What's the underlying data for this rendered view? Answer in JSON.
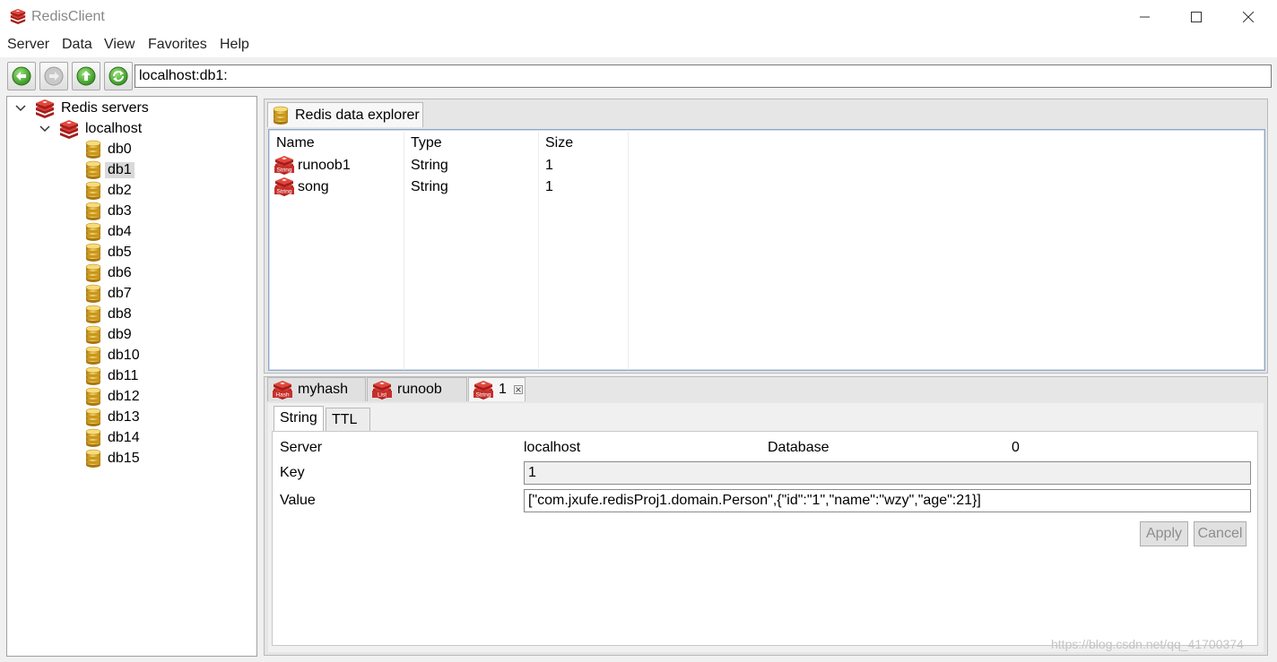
{
  "window": {
    "title": "RedisClient",
    "app_icon": "redis-icon",
    "controls": [
      "minimize-icon",
      "maximize-icon",
      "close-icon"
    ]
  },
  "menu": [
    "Server",
    "Data",
    "View",
    "Favorites",
    "Help"
  ],
  "toolbar": {
    "buttons": [
      "back-icon",
      "forward-icon",
      "up-icon",
      "refresh-icon"
    ],
    "address": "localhost:db1:"
  },
  "tree": {
    "root": "Redis servers",
    "server": "localhost",
    "databases": [
      "db0",
      "db1",
      "db2",
      "db3",
      "db4",
      "db5",
      "db6",
      "db7",
      "db8",
      "db9",
      "db10",
      "db11",
      "db12",
      "db13",
      "db14",
      "db15"
    ],
    "selected": "db1"
  },
  "explorer": {
    "tab_label": "Redis data explorer",
    "columns": [
      "Name",
      "Type",
      "Size"
    ],
    "rows": [
      {
        "icon_text": "String",
        "name": "runoob1",
        "type": "String",
        "size": "1"
      },
      {
        "icon_text": "String",
        "name": "song",
        "type": "String",
        "size": "1"
      }
    ]
  },
  "detail": {
    "tabs": [
      {
        "icon_text": "Hash",
        "label": "myhash"
      },
      {
        "icon_text": "List",
        "label": "runoob"
      },
      {
        "icon_text": "String",
        "label": "1",
        "closable": true
      }
    ],
    "inner_tabs": [
      "String",
      "TTL"
    ],
    "server_label": "Server",
    "server_value": "localhost",
    "database_label": "Database",
    "database_value": "0",
    "key_label": "Key",
    "key_value": "1",
    "value_label": "Value",
    "value_value": "[\"com.jxufe.redisProj1.domain.Person\",{\"id\":\"1\",\"name\":\"wzy\",\"age\":21}]",
    "apply_label": "Apply",
    "cancel_label": "Cancel"
  },
  "watermark": "https://blog.csdn.net/qq_41700374",
  "colors": {
    "redis_red": "#c6302b",
    "db_gold": "#d9a520",
    "nav_green": "#3fae2a"
  }
}
